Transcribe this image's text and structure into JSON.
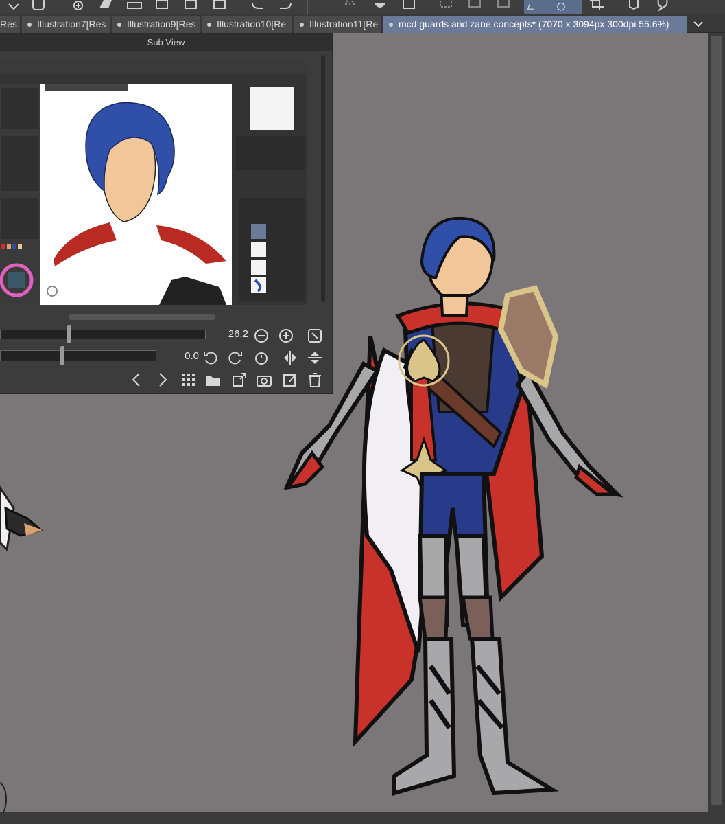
{
  "toolbar": {
    "icons": [
      "chevron-down-icon",
      "layer-stack-icon",
      "add-layer-icon",
      "folder-icon",
      "eraser-icon",
      "fill-icon",
      "export-icon",
      "undo-icon",
      "redo-icon",
      "spinner-icon",
      "heart-icon",
      "transform-icon",
      "selection-icon",
      "move-icon",
      "snap-icon",
      "crop-icon",
      "comment-icon"
    ]
  },
  "tabs": [
    {
      "label": "Res",
      "active": false
    },
    {
      "label": "Illustration7[Res",
      "active": false
    },
    {
      "label": "Illustration9[Res",
      "active": false
    },
    {
      "label": "Illustration10[Re",
      "active": false
    },
    {
      "label": "Illustration11[Re",
      "active": false
    },
    {
      "label": "mcd guards and zane concepts* (7070 x 3094px 300dpi 55.6%)",
      "active": true
    }
  ],
  "subview": {
    "title": "Sub View",
    "zoom_value": "26.2",
    "rotation_value": "0.0"
  },
  "colors": {
    "canvas": "#7b7778",
    "panel": "#3c3c3c",
    "active_tab": "#6b7a98",
    "hair": "#2f4fa8",
    "cape_red": "#c8322a",
    "armor_gray": "#a8a8ab",
    "gold": "#d9c48a",
    "skin": "#f1c79a"
  }
}
